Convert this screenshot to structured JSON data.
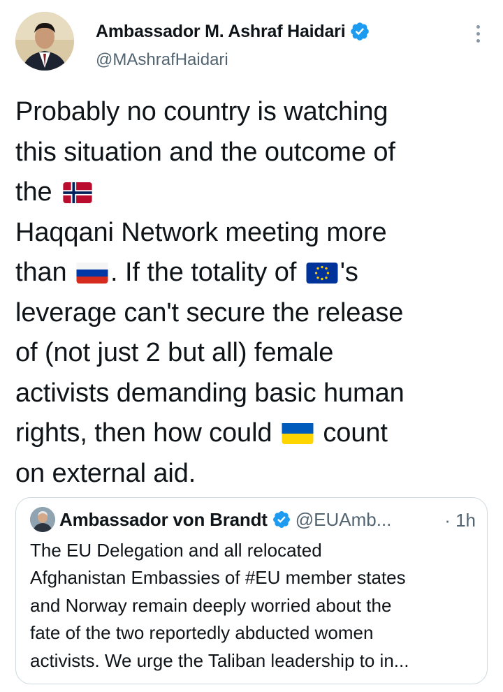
{
  "author": {
    "name": "Ambassador M. Ashraf Haidari",
    "handle": "@MAshrafHaidari",
    "verified": true
  },
  "tweet": {
    "lines": [
      "Probably no country is watching",
      "this situation and the outcome of",
      "the",
      "Haqqani Network meeting more",
      "than",
      ". If the totality of",
      "'s",
      "leverage can't secure the release",
      "of (not just 2 but all) female",
      "activists demanding basic human",
      "rights, then how could",
      "count",
      "on external aid."
    ],
    "flags": [
      "norway",
      "russia",
      "european-union",
      "ukraine"
    ]
  },
  "quoted": {
    "name": "Ambassador von Brandt",
    "handle": "@EUAmb...",
    "time": "· 1h",
    "lines": [
      "The EU Delegation and all relocated",
      "Afghanistan Embassies of #EU member states",
      "and Norway remain deeply worried about the",
      "fate of the two reportedly abducted women",
      "activists. We urge the Taliban leadership to in..."
    ]
  },
  "colors": {
    "text": "#0f1419",
    "secondary": "#536471",
    "verified": "#1d9bf0",
    "border": "#cfd9de"
  },
  "icons": [
    "verified-badge-icon",
    "more-options-icon"
  ]
}
